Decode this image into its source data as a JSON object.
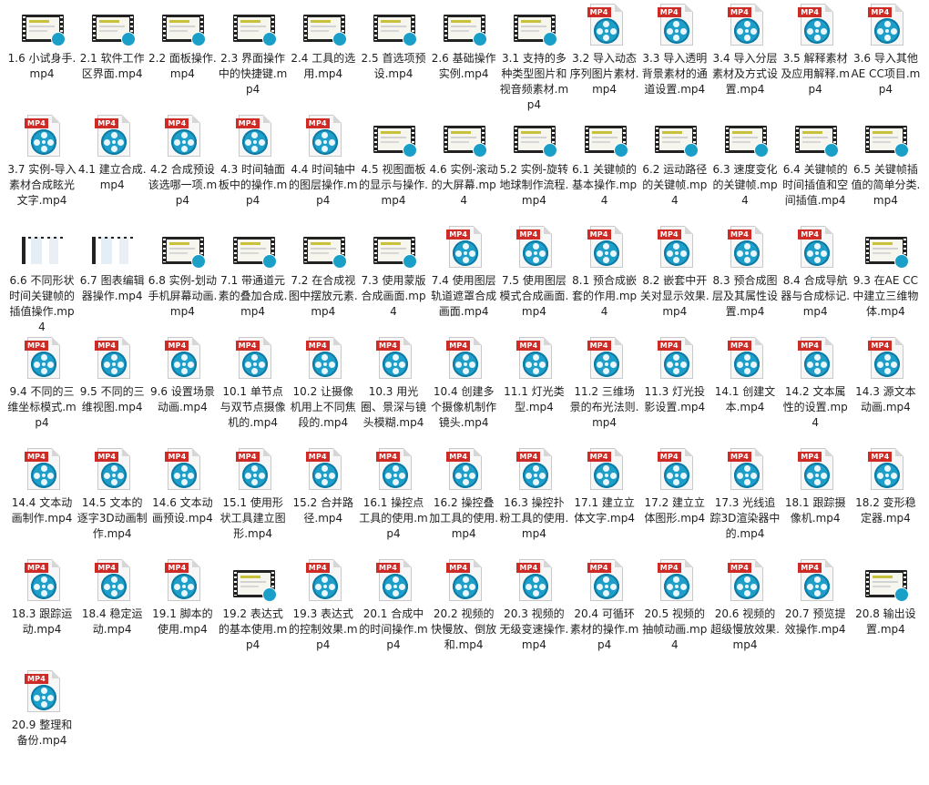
{
  "files": [
    {
      "name": "1.6 小试身手.mp4",
      "icon": "thumb"
    },
    {
      "name": "2.1 软件工作区界面.mp4",
      "icon": "thumb"
    },
    {
      "name": "2.2 面板操作.mp4",
      "icon": "thumb"
    },
    {
      "name": "2.3 界面操作中的快捷键.mp4",
      "icon": "thumb"
    },
    {
      "name": "2.4 工具的选用.mp4",
      "icon": "thumb"
    },
    {
      "name": "2.5 首选项预设.mp4",
      "icon": "thumb"
    },
    {
      "name": "2.6 基础操作实例.mp4",
      "icon": "thumb"
    },
    {
      "name": "3.1 支持的多种类型图片和视音频素材.mp4",
      "icon": "thumb"
    },
    {
      "name": "3.2 导入动态序列图片素材.mp4",
      "icon": "mp4"
    },
    {
      "name": "3.3 导入透明背景素材的通道设置.mp4",
      "icon": "mp4"
    },
    {
      "name": "3.4 导入分层素材及方式设置.mp4",
      "icon": "mp4"
    },
    {
      "name": "3.5 解释素材及应用解释.mp4",
      "icon": "mp4"
    },
    {
      "name": "3.6 导入其他AE CC项目.mp4",
      "icon": "mp4"
    },
    {
      "name": "3.7 实例-导入素材合成眩光文字.mp4",
      "icon": "mp4"
    },
    {
      "name": "4.1 建立合成.mp4",
      "icon": "mp4"
    },
    {
      "name": "4.2 合成预设该选哪一项.mp4",
      "icon": "mp4"
    },
    {
      "name": "4.3 时间轴面板中的操作.mp4",
      "icon": "mp4"
    },
    {
      "name": "4.4 时间轴中的图层操作.mp4",
      "icon": "mp4"
    },
    {
      "name": "4.5 视图面板的显示与操作.mp4",
      "icon": "thumb"
    },
    {
      "name": "4.6 实例-滚动的大屏幕.mp4",
      "icon": "thumb"
    },
    {
      "name": "5.2 实例-旋转地球制作流程.mp4",
      "icon": "thumb"
    },
    {
      "name": "6.1 关键帧的基本操作.mp4",
      "icon": "thumb"
    },
    {
      "name": "6.2 运动路径的关键帧.mp4",
      "icon": "thumb"
    },
    {
      "name": "6.3 速度变化的关键帧.mp4",
      "icon": "thumb"
    },
    {
      "name": "6.4 关键帧的时间插值和空间插值.mp4",
      "icon": "thumb"
    },
    {
      "name": "6.5 关键帧插值的简单分类.mp4",
      "icon": "thumb"
    },
    {
      "name": "6.6 不同形状时间关键帧的插值操作.mp4",
      "icon": "loading"
    },
    {
      "name": "6.7 图表编辑器操作.mp4",
      "icon": "loading"
    },
    {
      "name": "6.8 实例-划动手机屏幕动画.mp4",
      "icon": "thumb"
    },
    {
      "name": "7.1 带通道元素的叠加合成.mp4",
      "icon": "thumb"
    },
    {
      "name": "7.2 在合成视图中摆放元素.mp4",
      "icon": "thumb"
    },
    {
      "name": "7.3 使用蒙版合成画面.mp4",
      "icon": "thumb"
    },
    {
      "name": "7.4 使用图层轨道遮罩合成画面.mp4",
      "icon": "mp4"
    },
    {
      "name": "7.5 使用图层模式合成画面.mp4",
      "icon": "mp4"
    },
    {
      "name": "8.1 预合成嵌套的作用.mp4",
      "icon": "mp4"
    },
    {
      "name": "8.2 嵌套中开关对显示效果.mp4",
      "icon": "mp4"
    },
    {
      "name": "8.3 预合成图层及其属性设置.mp4",
      "icon": "mp4"
    },
    {
      "name": "8.4 合成导航器与合成标记.mp4",
      "icon": "mp4"
    },
    {
      "name": "9.3 在AE CC 中建立三维物体.mp4",
      "icon": "thumb"
    },
    {
      "name": "9.4 不同的三维坐标模式.mp4",
      "icon": "mp4"
    },
    {
      "name": "9.5 不同的三维视图.mp4",
      "icon": "mp4"
    },
    {
      "name": "9.6 设置场景动画.mp4",
      "icon": "mp4"
    },
    {
      "name": "10.1 单节点与双节点摄像机的.mp4",
      "icon": "mp4"
    },
    {
      "name": "10.2 让摄像机用上不同焦段的.mp4",
      "icon": "mp4"
    },
    {
      "name": "10.3 用光圈、景深与镜头模糊.mp4",
      "icon": "mp4"
    },
    {
      "name": "10.4 创建多个摄像机制作镜头.mp4",
      "icon": "mp4"
    },
    {
      "name": "11.1 灯光类型.mp4",
      "icon": "mp4"
    },
    {
      "name": "11.2 三维场景的布光法则.mp4",
      "icon": "mp4"
    },
    {
      "name": "11.3 灯光投影设置.mp4",
      "icon": "mp4"
    },
    {
      "name": "14.1 创建文本.mp4",
      "icon": "mp4"
    },
    {
      "name": "14.2 文本属性的设置.mp4",
      "icon": "mp4"
    },
    {
      "name": "14.3 源文本动画.mp4",
      "icon": "mp4"
    },
    {
      "name": "14.4 文本动画制作.mp4",
      "icon": "mp4"
    },
    {
      "name": "14.5 文本的逐字3D动画制作.mp4",
      "icon": "mp4"
    },
    {
      "name": "14.6 文本动画预设.mp4",
      "icon": "mp4"
    },
    {
      "name": "15.1 使用形状工具建立图形.mp4",
      "icon": "mp4"
    },
    {
      "name": "15.2 合并路径.mp4",
      "icon": "mp4"
    },
    {
      "name": "16.1 操控点工具的使用.mp4",
      "icon": "mp4"
    },
    {
      "name": "16.2 操控叠加工具的使用.mp4",
      "icon": "mp4"
    },
    {
      "name": "16.3 操控扑粉工具的使用.mp4",
      "icon": "mp4"
    },
    {
      "name": "17.1 建立立体文字.mp4",
      "icon": "mp4"
    },
    {
      "name": "17.2 建立立体图形.mp4",
      "icon": "mp4"
    },
    {
      "name": "17.3 光线追踪3D渲染器中的.mp4",
      "icon": "mp4"
    },
    {
      "name": "18.1 跟踪摄像机.mp4",
      "icon": "mp4"
    },
    {
      "name": "18.2 变形稳定器.mp4",
      "icon": "mp4"
    },
    {
      "name": "18.3 跟踪运动.mp4",
      "icon": "mp4"
    },
    {
      "name": "18.4 稳定运动.mp4",
      "icon": "mp4"
    },
    {
      "name": "19.1 脚本的使用.mp4",
      "icon": "mp4"
    },
    {
      "name": "19.2 表达式的基本使用.mp4",
      "icon": "thumb"
    },
    {
      "name": "19.3 表达式的控制效果.mp4",
      "icon": "mp4"
    },
    {
      "name": "20.1 合成中的时间操作.mp4",
      "icon": "mp4"
    },
    {
      "name": "20.2 视频的快慢放、倒放和.mp4",
      "icon": "mp4"
    },
    {
      "name": "20.3 视频的无级变速操作.mp4",
      "icon": "mp4"
    },
    {
      "name": "20.4 可循环素材的操作.mp4",
      "icon": "mp4"
    },
    {
      "name": "20.5 视频的抽帧动画.mp4",
      "icon": "mp4"
    },
    {
      "name": "20.6 视频的超级慢放效果.mp4",
      "icon": "mp4"
    },
    {
      "name": "20.7 预览提效操作.mp4",
      "icon": "mp4"
    },
    {
      "name": "20.8 输出设置.mp4",
      "icon": "thumb"
    },
    {
      "name": "20.9 整理和备份.mp4",
      "icon": "mp4"
    }
  ],
  "icon_badge_text": "MP4",
  "colors": {
    "mp4_tag": "#cf2b26",
    "reel": "#1d9fc9"
  }
}
